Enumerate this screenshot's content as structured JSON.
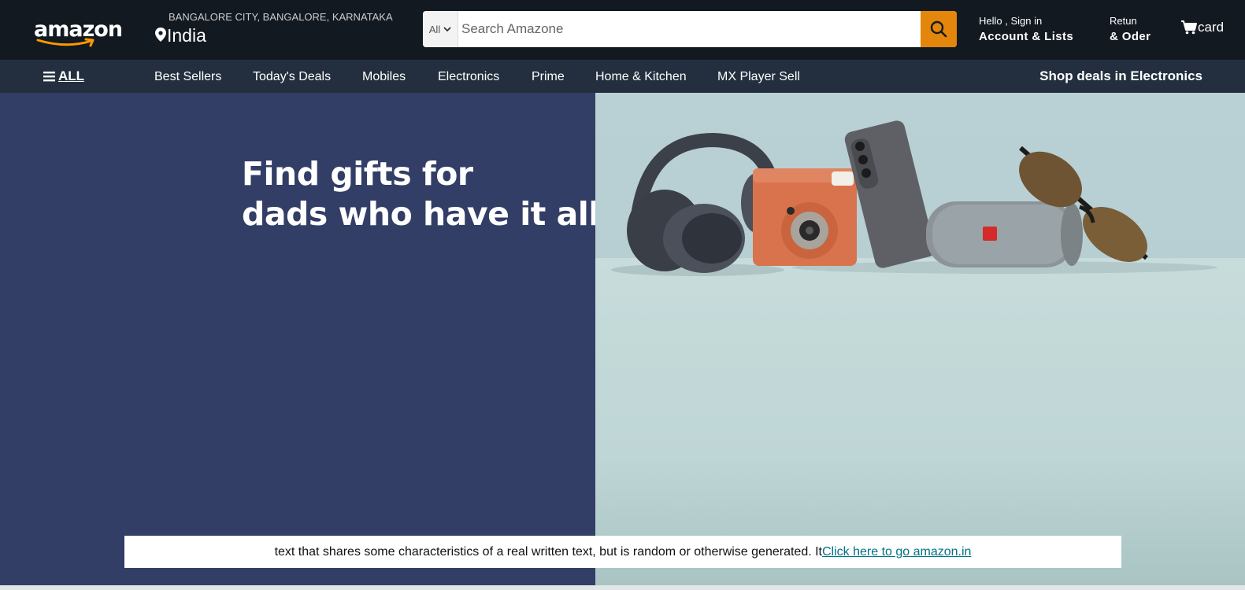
{
  "header": {
    "logo_text": "amazon",
    "location_line1": "BANGALORE CITY, BANGALORE, KARNATAKA",
    "location_line2": "India",
    "search": {
      "category": "All",
      "placeholder": "Search Amazone"
    },
    "account": {
      "line1": "Hello , Sign in",
      "line2": "Account & Lists"
    },
    "returns": {
      "line1": "Retun",
      "line2": "& Oder"
    },
    "cart_label": "card"
  },
  "nav": {
    "all_label": "ALL",
    "items": [
      "Best Sellers",
      "Today's Deals",
      "Mobiles",
      "Electronics",
      "Prime",
      "Home & Kitchen",
      "MX Player Sell"
    ],
    "deal_label": "Shop deals in Electronics"
  },
  "hero": {
    "title_line1": "Find gifts for",
    "title_line2": "dads who have it all"
  },
  "banner": {
    "text": "text that shares some characteristics of a real written text, but is random or otherwise generated. It",
    "link": "Click here to go amazon.in"
  },
  "colors": {
    "header_bg": "#131921",
    "nav_bg": "#232f3e",
    "accent_orange": "#e3860b",
    "hero_left_bg": "#323e66",
    "link_color": "#007185"
  }
}
